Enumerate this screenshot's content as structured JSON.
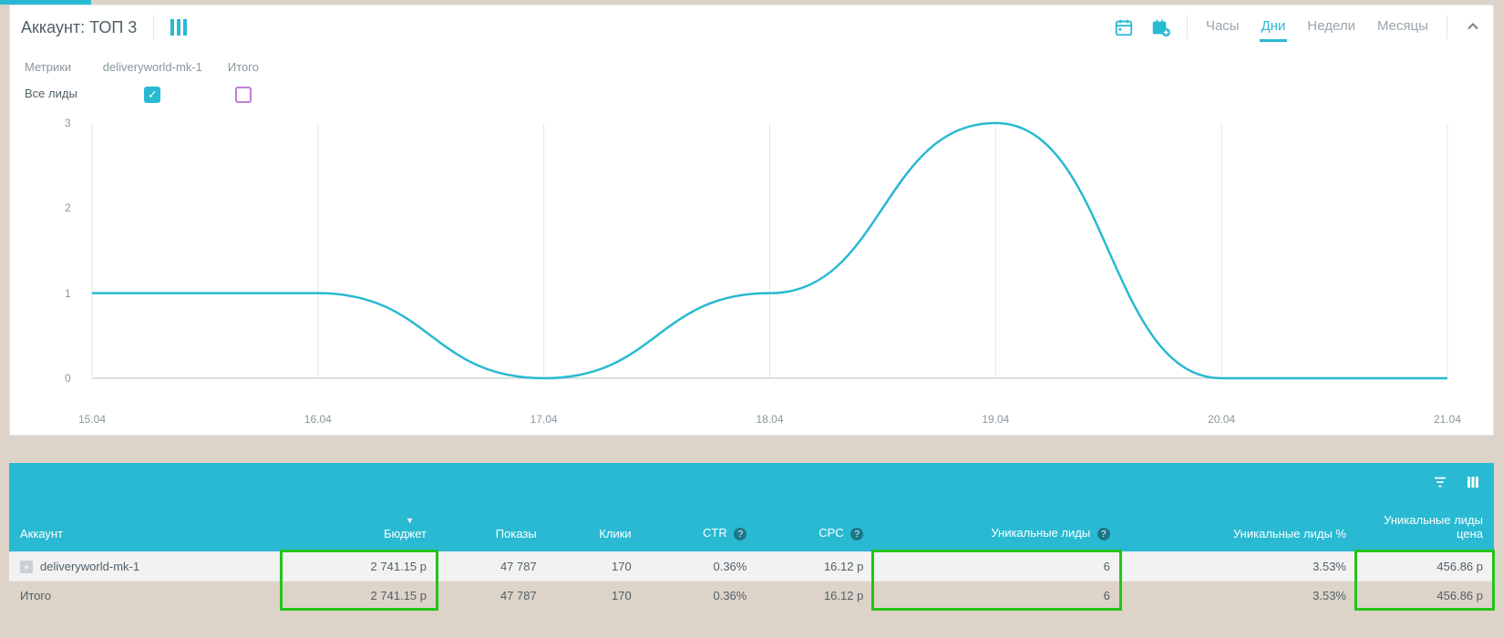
{
  "header": {
    "account_prefix": "Аккаунт:",
    "account_name": "ТОП 3",
    "calendar_icon": "calendar-icon",
    "calendar_add_icon": "calendar-plus-icon",
    "period_tabs": {
      "hours": "Часы",
      "days": "Дни",
      "weeks": "Недели",
      "months": "Месяцы"
    },
    "active_period": "days"
  },
  "metrics": {
    "labels": {
      "metrics": "Метрики",
      "series1": "deliveryworld-mk-1",
      "total": "Итого",
      "all_leads": "Все лиды"
    },
    "series1_checked": true,
    "total_checked": false
  },
  "chart_data": {
    "type": "line",
    "xlabel": "",
    "ylabel": "",
    "categories": [
      "15.04",
      "16.04",
      "17.04",
      "18.04",
      "19.04",
      "20.04",
      "21.04"
    ],
    "series": [
      {
        "name": "deliveryworld-mk-1",
        "values": [
          1,
          1,
          0,
          1,
          3,
          0,
          0
        ]
      }
    ],
    "ylim": [
      0,
      3
    ],
    "y_ticks": [
      0,
      1,
      2,
      3
    ]
  },
  "table": {
    "columns": {
      "account": "Аккаунт",
      "budget": "Бюджет",
      "impressions": "Показы",
      "clicks": "Клики",
      "ctr": "CTR",
      "cpc": "CPC",
      "uniq_leads": "Уникальные лиды",
      "uniq_leads_pct": "Уникальные лиды %",
      "uniq_leads_price": "Уникальные лиды цена"
    },
    "sort_column": "budget",
    "rows": [
      {
        "expandable": true,
        "account": "deliveryworld-mk-1",
        "budget": "2 741.15 р",
        "impressions": "47 787",
        "clicks": "170",
        "ctr": "0.36%",
        "cpc": "16.12 р",
        "uniq_leads": "6",
        "uniq_leads_pct": "3.53%",
        "uniq_leads_price": "456.86 р"
      }
    ],
    "total": {
      "account": "Итого",
      "budget": "2 741.15 р",
      "impressions": "47 787",
      "clicks": "170",
      "ctr": "0.36%",
      "cpc": "16.12 р",
      "uniq_leads": "6",
      "uniq_leads_pct": "3.53%",
      "uniq_leads_price": "456.86 р"
    },
    "highlight_columns": [
      "budget",
      "uniq_leads",
      "uniq_leads_price"
    ]
  },
  "icons": {
    "checkmark": "✓",
    "help": "?",
    "plus": "+"
  }
}
